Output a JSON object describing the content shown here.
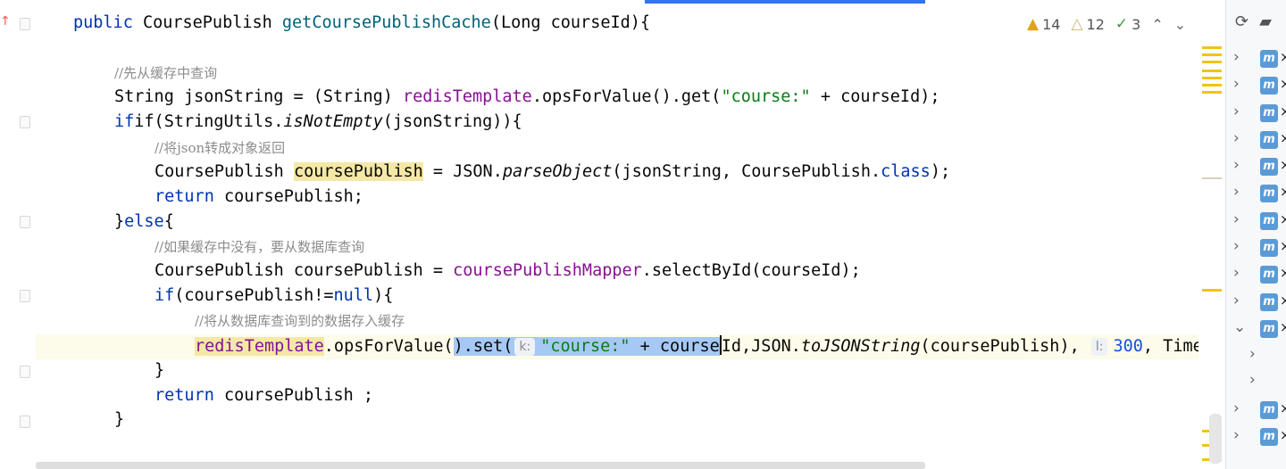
{
  "inspections": {
    "warnings": "14",
    "weak_warnings": "12",
    "typos": "3"
  },
  "hints": {
    "key_param": "k:",
    "timeout_param": "l:"
  },
  "code": {
    "l1": {
      "kw": "public",
      "type": "CoursePublish",
      "method": "getCoursePublishCache",
      "params": "(Long courseId){"
    },
    "l2": {
      "comment": "//先从缓存中查询"
    },
    "l3": {
      "a": "String jsonString = (String) ",
      "field": "redisTemplate",
      "b": ".opsForValue().get(",
      "str": "\"course:\"",
      "c": " + courseId);"
    },
    "l4": {
      "a": "if(StringUtils.",
      "italic": "isNotEmpty",
      "b": "(jsonString)){"
    },
    "l5": {
      "comment": "//将json转成对象返回"
    },
    "l6": {
      "a": "CoursePublish ",
      "hl": "coursePublish",
      "b": " = JSON.",
      "italic": "parseObject",
      "c": "(jsonString, CoursePublish.",
      "kw": "class",
      "d": ");"
    },
    "l7": {
      "kw": "return",
      "a": " coursePublish;"
    },
    "l8": {
      "a": "}",
      "kw": "else",
      "b": "{"
    },
    "l9": {
      "comment": "//如果缓存中没有，要从数据库查询"
    },
    "l10": {
      "a": "CoursePublish coursePublish = ",
      "field": "coursePublishMapper",
      "b": ".selectById(courseId);"
    },
    "l11": {
      "kw": "if",
      "a": "(coursePublish!=",
      "kw2": "null",
      "b": "){"
    },
    "l12": {
      "comment": "//将从数据库查询到的数据存入缓存"
    },
    "l13": {
      "field": "redisTemplate",
      "a": ".opsForValue(",
      "sel1": ").set(",
      "str": "\"course:\"",
      "sel2": " + course",
      "b": "Id,JSON.",
      "italic": "toJSONString",
      "c": "(coursePublish), ",
      "num": "300",
      "d": ", TimeUn"
    },
    "l14": {
      "a": "}"
    },
    "l15": {
      "kw": "return",
      "a": " coursePublish ;"
    },
    "l16": {
      "a": "}"
    }
  },
  "project_tree": {
    "file_icon_letter": "m",
    "close_glyph": "×"
  }
}
